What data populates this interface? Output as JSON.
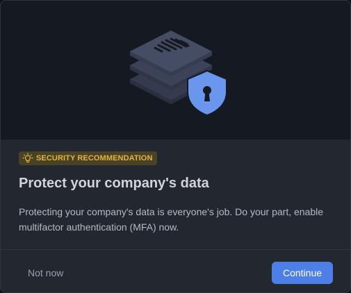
{
  "dialog": {
    "hero_icon": "layered-database-with-shield-lock",
    "badge": {
      "icon": "lightbulb-icon",
      "label": "SECURITY RECOMMENDATION"
    },
    "title": "Protect your company's data",
    "description": "Protecting your company's data is everyone's job. Do your part, enable multifactor authentication (MFA) now.",
    "actions": {
      "secondary_label": "Not now",
      "primary_label": "Continue"
    }
  },
  "colors": {
    "accent": "#4d7fe8",
    "badge_background": "#4a4227",
    "badge_text": "#e3b341",
    "shield": "#6a96ee"
  }
}
